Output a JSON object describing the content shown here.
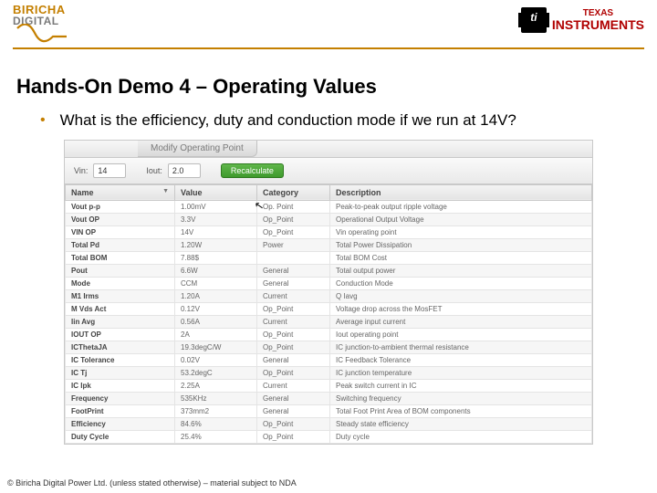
{
  "header": {
    "biricha_top": "BIRICHA",
    "biricha_bot": "DIGITAL",
    "ti_top": "TEXAS",
    "ti_bot": "INSTRUMENTS"
  },
  "title": "Hands-On Demo 4 – Operating Values",
  "bullet": "What is the efficiency, duty and conduction mode if we run at 14V?",
  "panel": {
    "modify_title": "Modify Operating Point",
    "vin_label": "Vin:",
    "vin_value": "14",
    "iout_label": "Iout:",
    "iout_value": "2.0",
    "recalc": "Recalculate"
  },
  "columns": {
    "name": "Name",
    "value": "Value",
    "category": "Category",
    "description": "Description"
  },
  "rows": [
    {
      "name": "Vout p-p",
      "value": "1.00mV",
      "category": "Op. Point",
      "description": "Peak-to-peak output ripple voltage"
    },
    {
      "name": "Vout OP",
      "value": "3.3V",
      "category": "Op_Point",
      "description": "Operational Output Voltage"
    },
    {
      "name": "VIN OP",
      "value": "14V",
      "category": "Op_Point",
      "description": "Vin operating point"
    },
    {
      "name": "Total Pd",
      "value": "1.20W",
      "category": "Power",
      "description": "Total Power Dissipation"
    },
    {
      "name": "Total BOM",
      "value": "7.88$",
      "category": "",
      "description": "Total BOM Cost"
    },
    {
      "name": "Pout",
      "value": "6.6W",
      "category": "General",
      "description": "Total output power"
    },
    {
      "name": "Mode",
      "value": "CCM",
      "category": "General",
      "description": "Conduction Mode"
    },
    {
      "name": "M1 Irms",
      "value": "1.20A",
      "category": "Current",
      "description": "Q Iavg"
    },
    {
      "name": "M Vds Act",
      "value": "0.12V",
      "category": "Op_Point",
      "description": "Voltage drop across the MosFET"
    },
    {
      "name": "Iin Avg",
      "value": "0.56A",
      "category": "Current",
      "description": "Average input current"
    },
    {
      "name": "IOUT OP",
      "value": "2A",
      "category": "Op_Point",
      "description": "Iout operating point"
    },
    {
      "name": "ICThetaJA",
      "value": "19.3degC/W",
      "category": "Op_Point",
      "description": "IC junction-to-ambient thermal resistance"
    },
    {
      "name": "IC Tolerance",
      "value": "0.02V",
      "category": "General",
      "description": "IC Feedback Tolerance"
    },
    {
      "name": "IC Tj",
      "value": "53.2degC",
      "category": "Op_Point",
      "description": "IC junction temperature"
    },
    {
      "name": "IC Ipk",
      "value": "2.25A",
      "category": "Current",
      "description": "Peak switch current in IC"
    },
    {
      "name": "Frequency",
      "value": "535KHz",
      "category": "General",
      "description": "Switching frequency"
    },
    {
      "name": "FootPrint",
      "value": "373mm2",
      "category": "General",
      "description": "Total Foot Print Area of BOM components"
    },
    {
      "name": "Efficiency",
      "value": "84.6%",
      "category": "Op_Point",
      "description": "Steady state efficiency"
    },
    {
      "name": "Duty Cycle",
      "value": "25.4%",
      "category": "Op_Point",
      "description": "Duty cycle"
    }
  ],
  "footer": "© Biricha Digital Power Ltd. (unless stated otherwise) – material subject to NDA"
}
